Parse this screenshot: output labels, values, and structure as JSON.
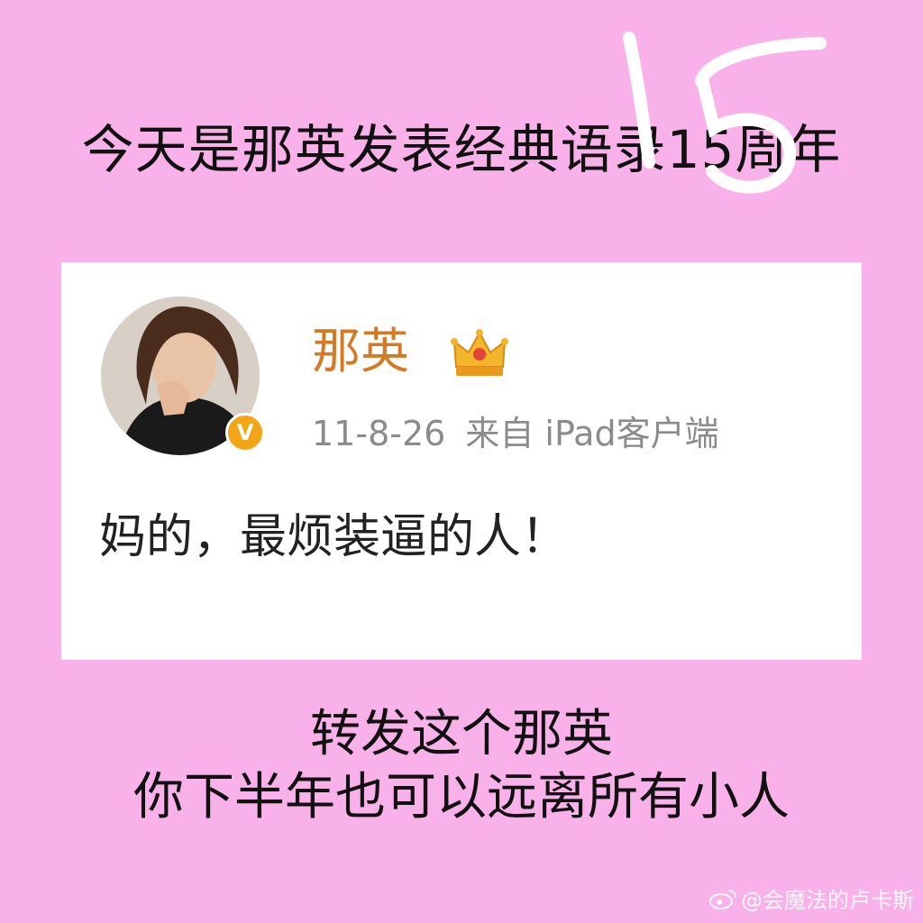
{
  "headline": "今天是那英发表经典语录15周年",
  "scribble_number": "15",
  "card": {
    "username": "那英",
    "date": "11-8-26",
    "source": "来自 iPad客户端",
    "post_text": "妈的，最烦装逼的人！",
    "verified_badge": "V",
    "crown_icon": "crown-icon",
    "colors": {
      "username": "#d57a24",
      "meta": "#8b8b8b",
      "badge": "#f2a516"
    }
  },
  "bottom_text": {
    "line1": "转发这个那英",
    "line2": "你下半年也可以远离所有小人"
  },
  "watermark": "@会魔法的卢卡斯",
  "background_color": "#f9b1e9"
}
